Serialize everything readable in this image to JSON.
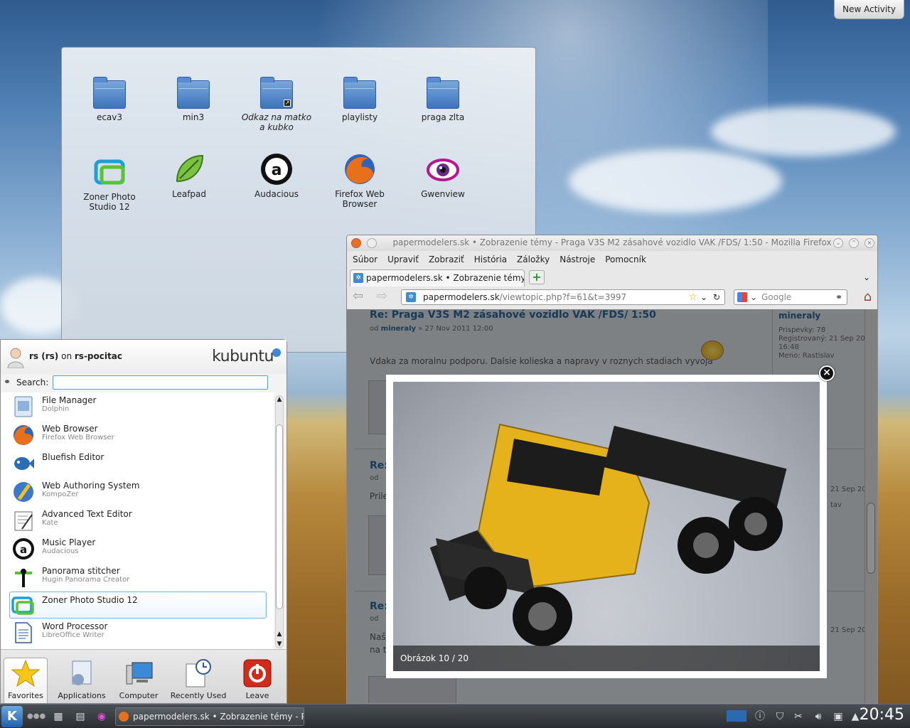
{
  "desktop": {
    "new_activity": "New Activity",
    "icons": [
      {
        "label": "ecav3",
        "type": "folder"
      },
      {
        "label": "min3",
        "type": "folder"
      },
      {
        "label": "Odkaz na matko a kubko",
        "type": "folder-link"
      },
      {
        "label": "playlisty",
        "type": "folder"
      },
      {
        "label": "praga zlta",
        "type": "folder"
      },
      {
        "label": "Zoner Photo Studio 12",
        "type": "zoner-icon"
      },
      {
        "label": "Leafpad",
        "type": "leafpad-icon"
      },
      {
        "label": "Audacious",
        "type": "audacious-icon"
      },
      {
        "label": "Firefox Web Browser",
        "type": "firefox-icon"
      },
      {
        "label": "Gwenview",
        "type": "gwenview-icon"
      }
    ]
  },
  "firefox": {
    "title": "papermodelers.sk • Zobrazenie témy - Praga V3S M2 zásahové vozidlo VAK /FDS/ 1:50 - Mozilla Firefox",
    "menu": [
      "Súbor",
      "Upraviť",
      "Zobraziť",
      "História",
      "Záložky",
      "Nástroje",
      "Pomocník"
    ],
    "tab_label": "papermodelers.sk • Zobrazenie témy -...",
    "url_domain": "papermodelers.sk",
    "url_path": "/viewtopic.php?f=61&t=3997",
    "search_placeholder": "Google",
    "page": {
      "post_title": "Re: Praga V3S M2 zásahové vozidlo VAK /FDS/ 1:50",
      "post_meta_prefix": "od",
      "post_author": "mineraly",
      "post_date": "» 27 Nov 2011 12:00",
      "post_text": "Vdaka za moralnu podporu. Dalsie kolieska a napravy v roznych stadiach vyvoja",
      "side_author": "mineraly",
      "side_posts": "Prispevky:  78",
      "side_reg": "Registrovaný:  21 Sep 20",
      "side_reg_time": "16:48",
      "side_name": "Meno:  Rastislav",
      "re2": "Re:",
      "od2": "od",
      "pri": "Prile",
      "date2": "21 Sep 20",
      "tav": "tav",
      "re3": "Re:",
      "od3": "od",
      "nas": "Naš",
      "na": "na t",
      "date3": "21 Sep 20"
    },
    "lightbox": {
      "caption": "Obrázok 10 / 20",
      "close": "×"
    }
  },
  "kickoff": {
    "user_name": "rs (rs)",
    "user_on": "on",
    "host": "rs-pocitac",
    "brand": "kubuntu",
    "search_label": "Search:",
    "search_value": "",
    "items": [
      {
        "title": "File Manager",
        "subtitle": "Dolphin"
      },
      {
        "title": "Web Browser",
        "subtitle": "Firefox Web Browser"
      },
      {
        "title": "Bluefish Editor",
        "subtitle": ""
      },
      {
        "title": "Web Authoring System",
        "subtitle": "KompoZer"
      },
      {
        "title": "Advanced Text Editor",
        "subtitle": "Kate"
      },
      {
        "title": "Music Player",
        "subtitle": "Audacious"
      },
      {
        "title": "Panorama stitcher",
        "subtitle": "Hugin Panorama Creator"
      },
      {
        "title": "Zoner Photo Studio 12",
        "subtitle": ""
      },
      {
        "title": "Word Processor",
        "subtitle": "LibreOffice Writer"
      }
    ],
    "tabs": [
      "Favorites",
      "Applications",
      "Computer",
      "Recently Used",
      "Leave"
    ]
  },
  "panel": {
    "task_label": "papermodelers.sk • Zobrazenie témy - Prag",
    "clock": "20:45"
  },
  "colors": {
    "accent": "#2a6496",
    "panel": "#2b2f33"
  }
}
